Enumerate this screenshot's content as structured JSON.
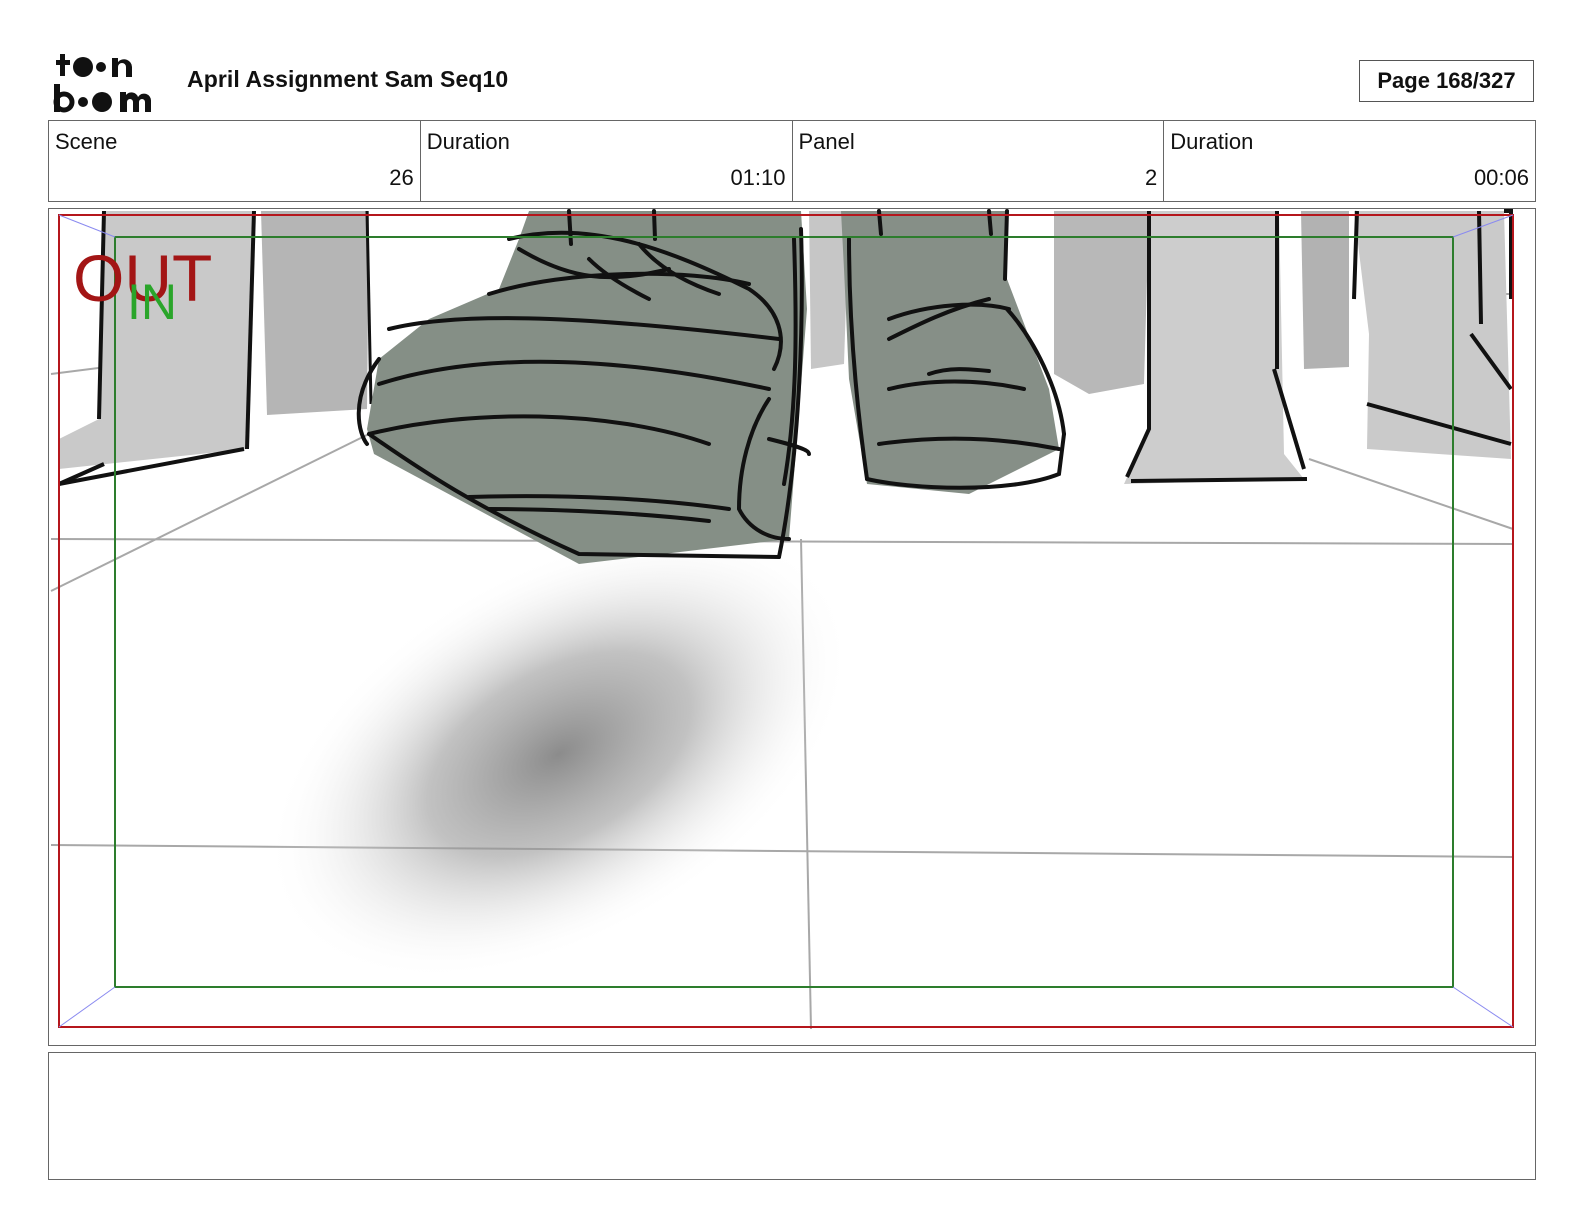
{
  "header": {
    "logo_top": "toon",
    "logo_bottom": "boom",
    "title": "April Assignment Sam Seq10",
    "page": "Page 168/327"
  },
  "info": {
    "scene_label": "Scene",
    "scene_value": "26",
    "scene_duration_label": "Duration",
    "scene_duration_value": "01:10",
    "panel_label": "Panel",
    "panel_value": "2",
    "panel_duration_label": "Duration",
    "panel_duration_value": "00:06"
  },
  "frame": {
    "out_label": "OUT",
    "in_label": "IN",
    "out_color": "#a31515",
    "in_color": "#2aa52a"
  },
  "notes": {
    "text": ""
  }
}
